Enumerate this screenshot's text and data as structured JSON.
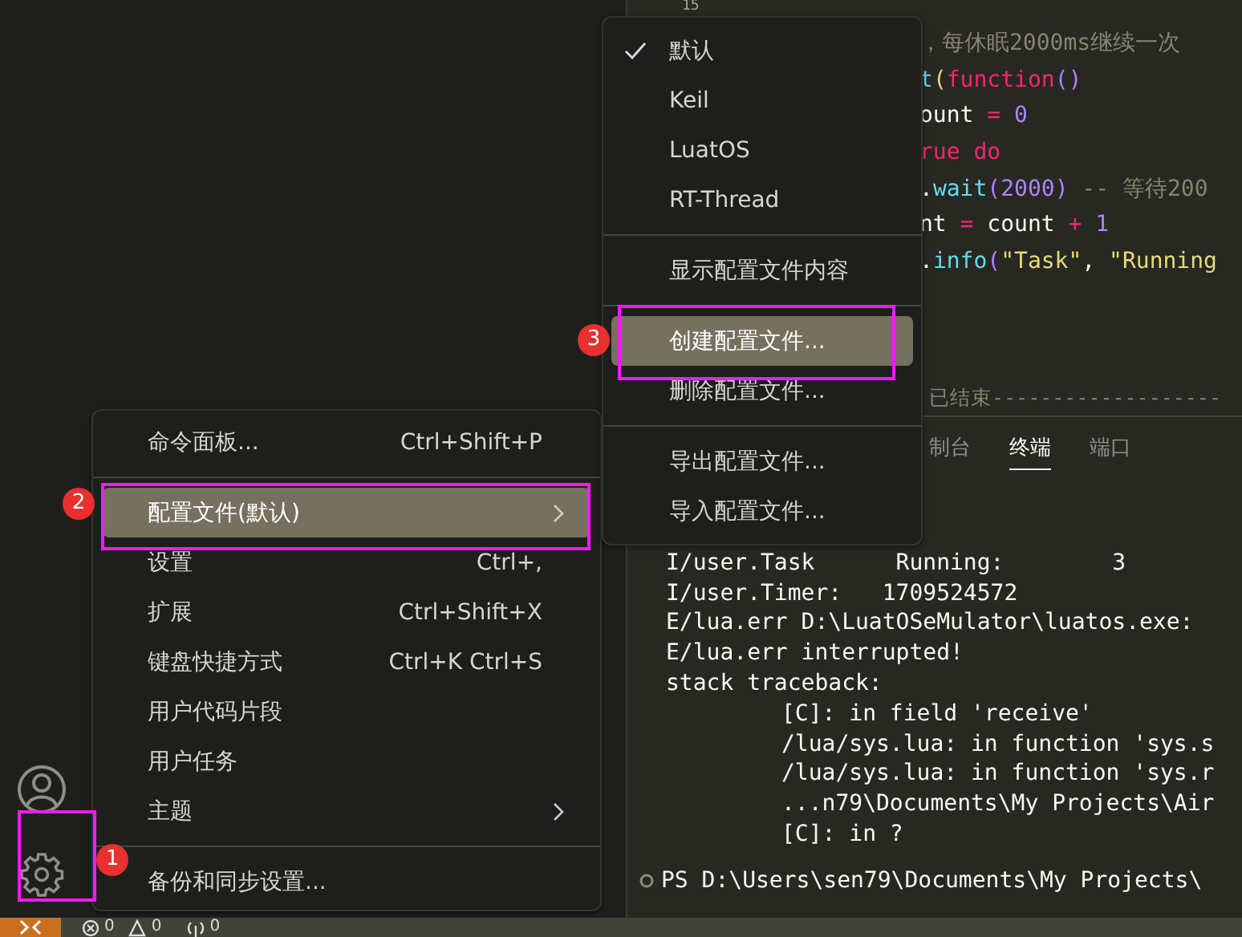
{
  "editor": {
    "line_number": "15",
    "code_lines": [
      [
        {
          "kind": "comment",
          "text": "，每休眠2000ms继续一次"
        }
      ],
      [
        {
          "kind": "func",
          "text": "t"
        },
        {
          "kind": "bracket1",
          "text": "("
        },
        {
          "kind": "keyword",
          "text": "function"
        },
        {
          "kind": "bracket2",
          "text": "()"
        }
      ],
      [
        {
          "kind": "plain",
          "text": "ount"
        },
        {
          "kind": "keyword",
          "text": " = "
        },
        {
          "kind": "number",
          "text": "0"
        }
      ],
      [
        {
          "kind": "keyword",
          "text": "rue do"
        }
      ],
      [
        {
          "kind": "plain",
          "text": "."
        },
        {
          "kind": "func",
          "text": "wait"
        },
        {
          "kind": "bracket2",
          "text": "("
        },
        {
          "kind": "number",
          "text": "2000"
        },
        {
          "kind": "bracket2",
          "text": ")"
        },
        {
          "kind": "comment",
          "text": " -- 等待200"
        }
      ],
      [
        {
          "kind": "plain",
          "text": "nt"
        },
        {
          "kind": "keyword",
          "text": " = "
        },
        {
          "kind": "plain",
          "text": "count"
        },
        {
          "kind": "keyword",
          "text": " + "
        },
        {
          "kind": "number",
          "text": "1"
        }
      ],
      [
        {
          "kind": "plain",
          "text": "."
        },
        {
          "kind": "func",
          "text": "info"
        },
        {
          "kind": "bracket2",
          "text": "("
        },
        {
          "kind": "string",
          "text": "\"Task\""
        },
        {
          "kind": "plain",
          "text": ", "
        },
        {
          "kind": "string",
          "text": "\"Running"
        }
      ]
    ],
    "output_end": "已结束-------------------"
  },
  "panel_tabs": [
    {
      "label": "制台",
      "selected": false
    },
    {
      "label": "终端",
      "selected": true
    },
    {
      "label": "端口",
      "selected": false
    }
  ],
  "terminal_lines": [
    {
      "text": "I/user.Task      Running:        3",
      "indented": false
    },
    {
      "text": "I/user.Timer:   1709524572",
      "indented": false
    },
    {
      "text": "E/lua.err D:\\LuatOSeMulator\\luatos.exe:",
      "indented": false
    },
    {
      "text": "E/lua.err interrupted!",
      "indented": false
    },
    {
      "text": "stack traceback:",
      "indented": false
    },
    {
      "text": "[C]: in field 'receive'",
      "indented": true
    },
    {
      "text": "/lua/sys.lua: in function 'sys.s",
      "indented": true
    },
    {
      "text": "/lua/sys.lua: in function 'sys.r",
      "indented": true
    },
    {
      "text": "...n79\\Documents\\My Projects\\Air",
      "indented": true
    },
    {
      "text": "[C]: in ?",
      "indented": true
    }
  ],
  "terminal_prompt": "PS D:\\Users\\sen79\\Documents\\My Projects\\",
  "manage_menu": [
    {
      "kind": "item",
      "label": "命令面板...",
      "shortcut": "Ctrl+Shift+P",
      "selected": false,
      "submenu": false
    },
    {
      "kind": "separator"
    },
    {
      "kind": "item",
      "label": "配置文件(默认)",
      "selected": true,
      "submenu": true
    },
    {
      "kind": "item",
      "label": "设置",
      "shortcut": "Ctrl+,",
      "selected": false,
      "submenu": false
    },
    {
      "kind": "item",
      "label": "扩展",
      "shortcut": "Ctrl+Shift+X",
      "selected": false,
      "submenu": false
    },
    {
      "kind": "item",
      "label": "键盘快捷方式",
      "shortcut": "Ctrl+K Ctrl+S",
      "selected": false,
      "submenu": false
    },
    {
      "kind": "item",
      "label": "用户代码片段",
      "selected": false,
      "submenu": false
    },
    {
      "kind": "item",
      "label": "用户任务",
      "selected": false,
      "submenu": false
    },
    {
      "kind": "item",
      "label": "主题",
      "selected": false,
      "submenu": true
    },
    {
      "kind": "separator"
    },
    {
      "kind": "item",
      "label": "备份和同步设置...",
      "selected": false,
      "submenu": false
    }
  ],
  "profile_menu": [
    {
      "kind": "item",
      "label": "默认",
      "checked": true,
      "selected": false
    },
    {
      "kind": "item",
      "label": "Keil",
      "checked": false,
      "selected": false
    },
    {
      "kind": "item",
      "label": "LuatOS",
      "checked": false,
      "selected": false
    },
    {
      "kind": "item",
      "label": "RT-Thread",
      "checked": false,
      "selected": false
    },
    {
      "kind": "separator"
    },
    {
      "kind": "item",
      "label": "显示配置文件内容",
      "checked": false,
      "selected": false
    },
    {
      "kind": "separator"
    },
    {
      "kind": "item",
      "label": "创建配置文件...",
      "checked": false,
      "selected": true
    },
    {
      "kind": "item",
      "label": "删除配置文件...",
      "checked": false,
      "selected": false
    },
    {
      "kind": "separator"
    },
    {
      "kind": "item",
      "label": "导出配置文件...",
      "checked": false,
      "selected": false
    },
    {
      "kind": "item",
      "label": "导入配置文件...",
      "checked": false,
      "selected": false
    }
  ],
  "annotations": [
    "1",
    "2",
    "3"
  ],
  "status_bar": {
    "errors": "0",
    "warnings": "0",
    "ports": "0"
  }
}
